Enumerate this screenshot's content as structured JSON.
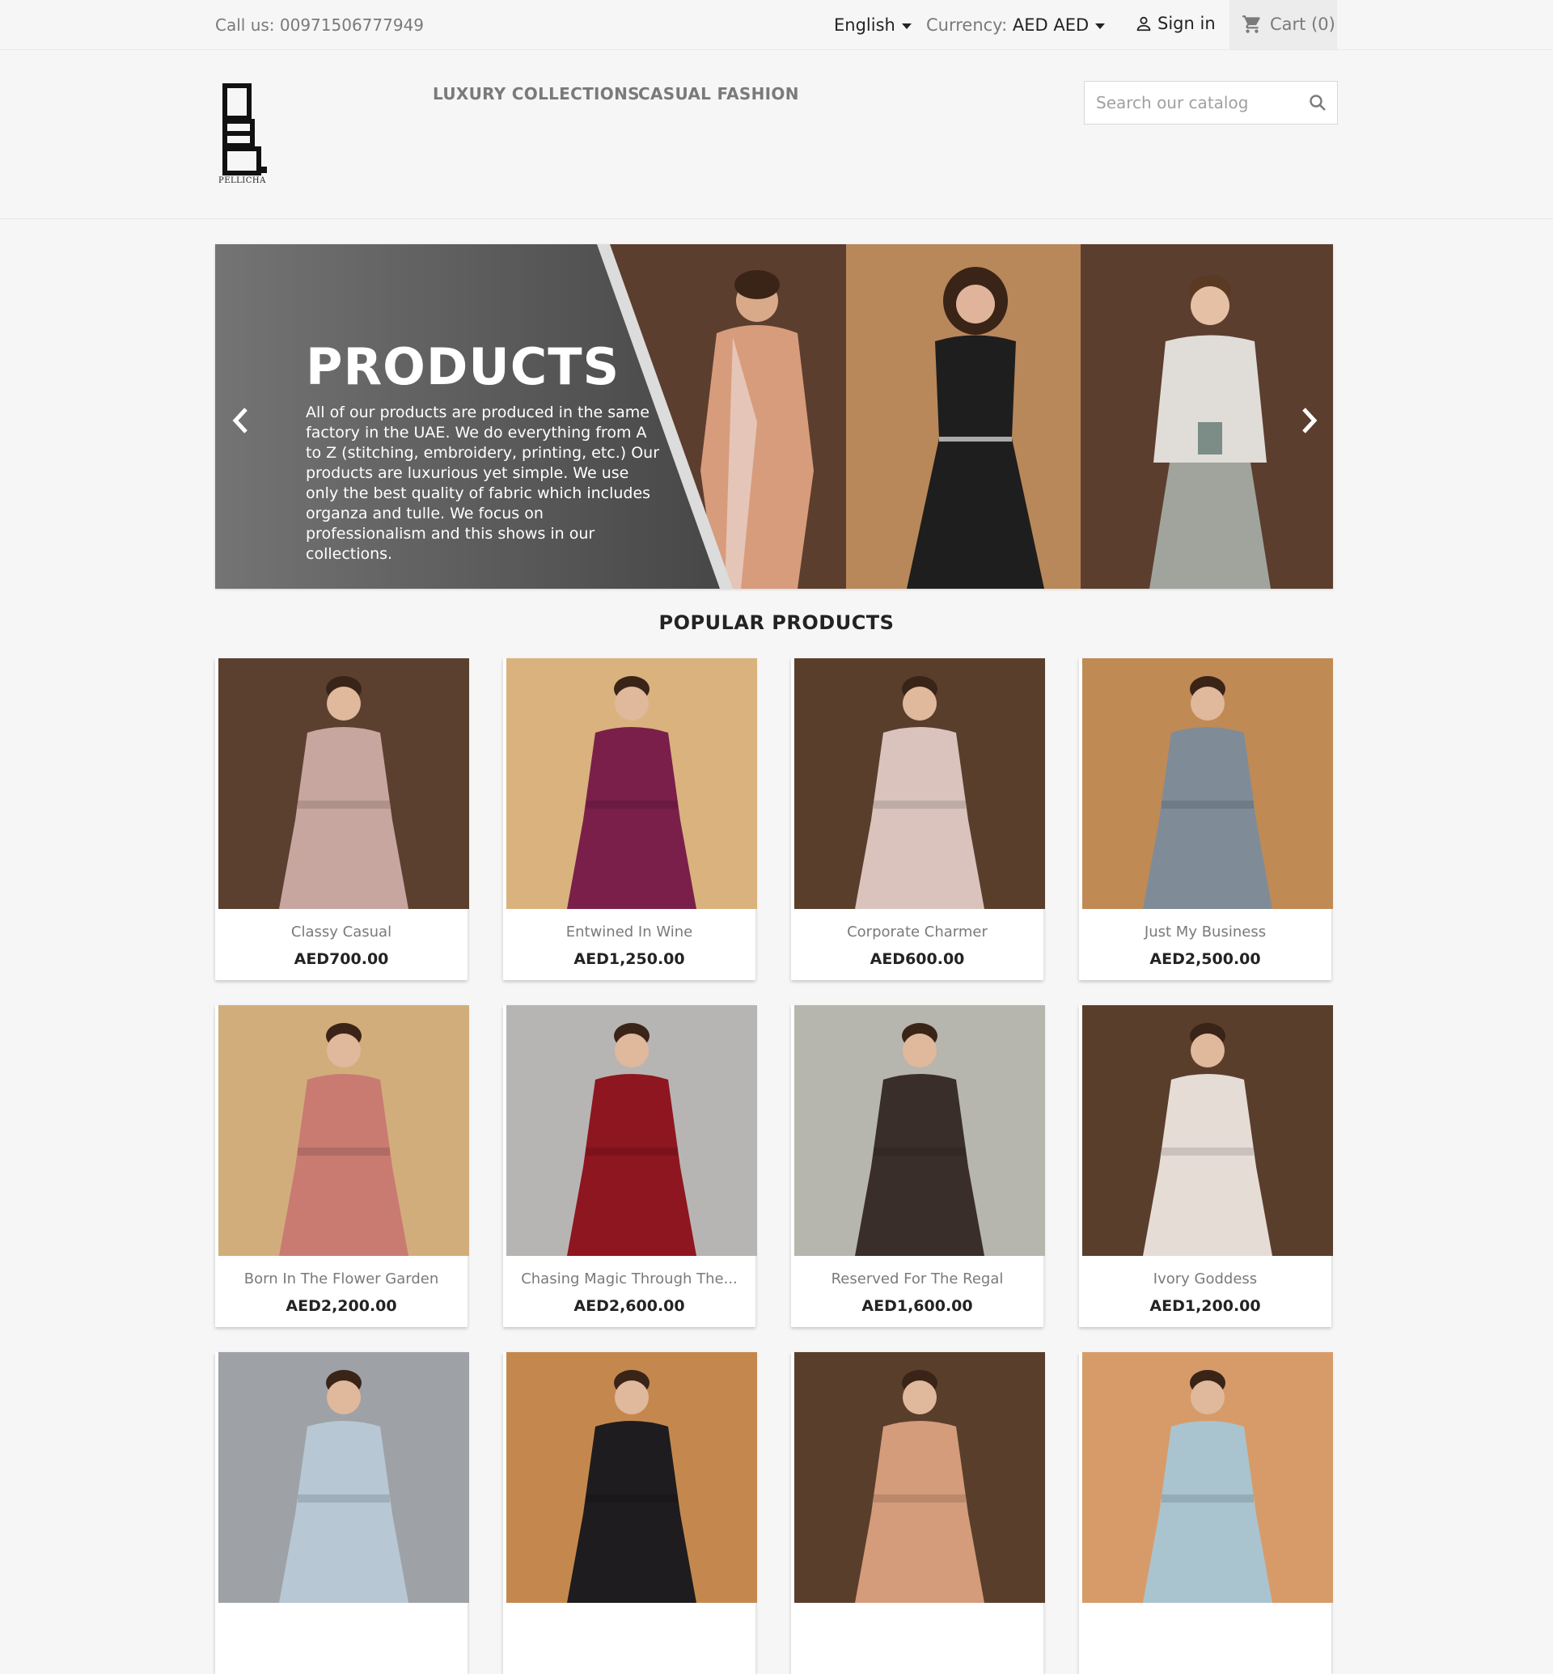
{
  "topbar": {
    "call": "Call us: 00971506777949",
    "language": "English",
    "currency_label": "Currency:",
    "currency_value": "AED AED",
    "sign_in": "Sign in",
    "cart": "Cart (0)"
  },
  "header": {
    "logo_text": "PELLICHA",
    "nav": [
      "LUXURY COLLECTIONS",
      "CASUAL FASHION"
    ],
    "search_placeholder": "Search our catalog"
  },
  "banner": {
    "title": "PRODUCTS",
    "description": "All of our products are produced in the same factory in the UAE. We do everything from A to Z (stitching, embroidery, printing, etc.) Our products are luxurious yet simple. We use only the best quality of fabric which includes organza and tulle. We focus on professionalism and this shows in our collections."
  },
  "popular": {
    "title": "POPULAR PRODUCTS",
    "products": [
      {
        "name": "Classy Casual",
        "price": "AED700.00",
        "bg": "#5b4030",
        "dress": "#c8a6a0"
      },
      {
        "name": "Entwined In Wine",
        "price": "AED1,250.00",
        "bg": "#d9b27e",
        "dress": "#7a1f4a"
      },
      {
        "name": "Corporate Charmer",
        "price": "AED600.00",
        "bg": "#5a3e2c",
        "dress": "#d9c3bc"
      },
      {
        "name": "Just My Business",
        "price": "AED2,500.00",
        "bg": "#c08a55",
        "dress": "#7f8c98"
      },
      {
        "name": "Born In The Flower Garden",
        "price": "AED2,200.00",
        "bg": "#d2ad7c",
        "dress": "#c97b72"
      },
      {
        "name": "Chasing Magic Through The...",
        "price": "AED2,600.00",
        "bg": "#b7b5b3",
        "dress": "#8e1620"
      },
      {
        "name": "Reserved For The Regal",
        "price": "AED1,600.00",
        "bg": "#b6b5ae",
        "dress": "#3a2e2a"
      },
      {
        "name": "Ivory Goddess",
        "price": "AED1,200.00",
        "bg": "#5a3e2c",
        "dress": "#e6dcd6"
      },
      {
        "name": "",
        "price": "",
        "bg": "#9ea2a6",
        "dress": "#b7c7d3"
      },
      {
        "name": "",
        "price": "",
        "bg": "#c4884e",
        "dress": "#1e1c1e"
      },
      {
        "name": "",
        "price": "",
        "bg": "#5a3e2c",
        "dress": "#d49c7a"
      },
      {
        "name": "",
        "price": "",
        "bg": "#d79b6a",
        "dress": "#a9c4cf"
      }
    ]
  }
}
